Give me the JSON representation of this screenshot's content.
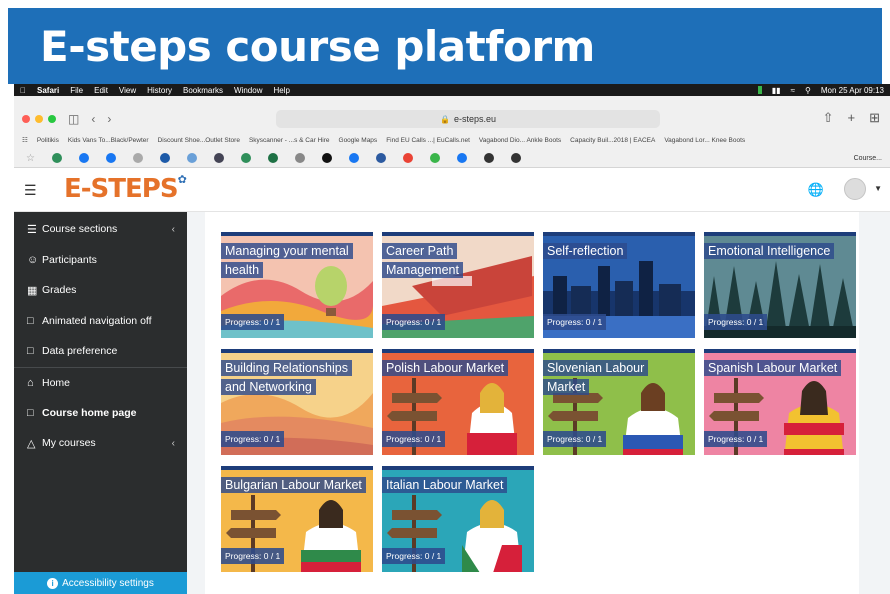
{
  "banner": {
    "title": "E-steps course platform"
  },
  "macbar": {
    "app": "Safari",
    "menus": [
      "File",
      "Edit",
      "View",
      "History",
      "Bookmarks",
      "Window",
      "Help"
    ],
    "datetime": "Mon 25 Apr 09:13"
  },
  "browser": {
    "url": "e-steps.eu",
    "bookmarks": [
      "Politikis",
      "Kids Vans To...Black/Pewter",
      "Discount Shoe...Outlet Store",
      "Skyscanner - ...s & Car Hire",
      "Google Maps",
      "Find EU Calls ...| EuCalls.net",
      "Vagabond Dio... Ankle Boots",
      "Capacity Buil...2018 | EACEA",
      "Vagabond Lor... Knee Boots"
    ],
    "active_tab": "Course..."
  },
  "site": {
    "logo": "E-STEPS"
  },
  "sidebar": {
    "items": [
      {
        "label": "Course sections",
        "icon": "list-icon"
      },
      {
        "label": "Participants",
        "icon": "users-icon"
      },
      {
        "label": "Grades",
        "icon": "table-icon"
      },
      {
        "label": "Animated navigation off",
        "icon": "folder-icon"
      },
      {
        "label": "Data preference",
        "icon": "folder-icon"
      },
      {
        "label": "Home",
        "icon": "home-icon"
      },
      {
        "label": "Course home page",
        "icon": "folder-icon"
      },
      {
        "label": "My courses",
        "icon": "graduation-cap-icon"
      }
    ],
    "accessibility": "Accessibility settings"
  },
  "courses": [
    {
      "title": "Managing your mental health",
      "progress": "Progress: 0 / 1"
    },
    {
      "title": "Career Path Management",
      "progress": "Progress: 0 / 1"
    },
    {
      "title": "Self-reflection",
      "progress": "Progress: 0 / 1"
    },
    {
      "title": "Emotional Intelligence",
      "progress": "Progress: 0 / 1"
    },
    {
      "title": "Building Relationships and Networking",
      "progress": "Progress: 0 / 1"
    },
    {
      "title": "Polish Labour Market",
      "progress": "Progress: 0 / 1"
    },
    {
      "title": "Slovenian Labour Market",
      "progress": "Progress: 0 / 1"
    },
    {
      "title": "Spanish Labour Market",
      "progress": "Progress: 0 / 1"
    },
    {
      "title": "Bulgarian Labour Market",
      "progress": "Progress: 0 / 1"
    },
    {
      "title": "Italian Labour Market",
      "progress": "Progress: 0 / 1"
    }
  ]
}
